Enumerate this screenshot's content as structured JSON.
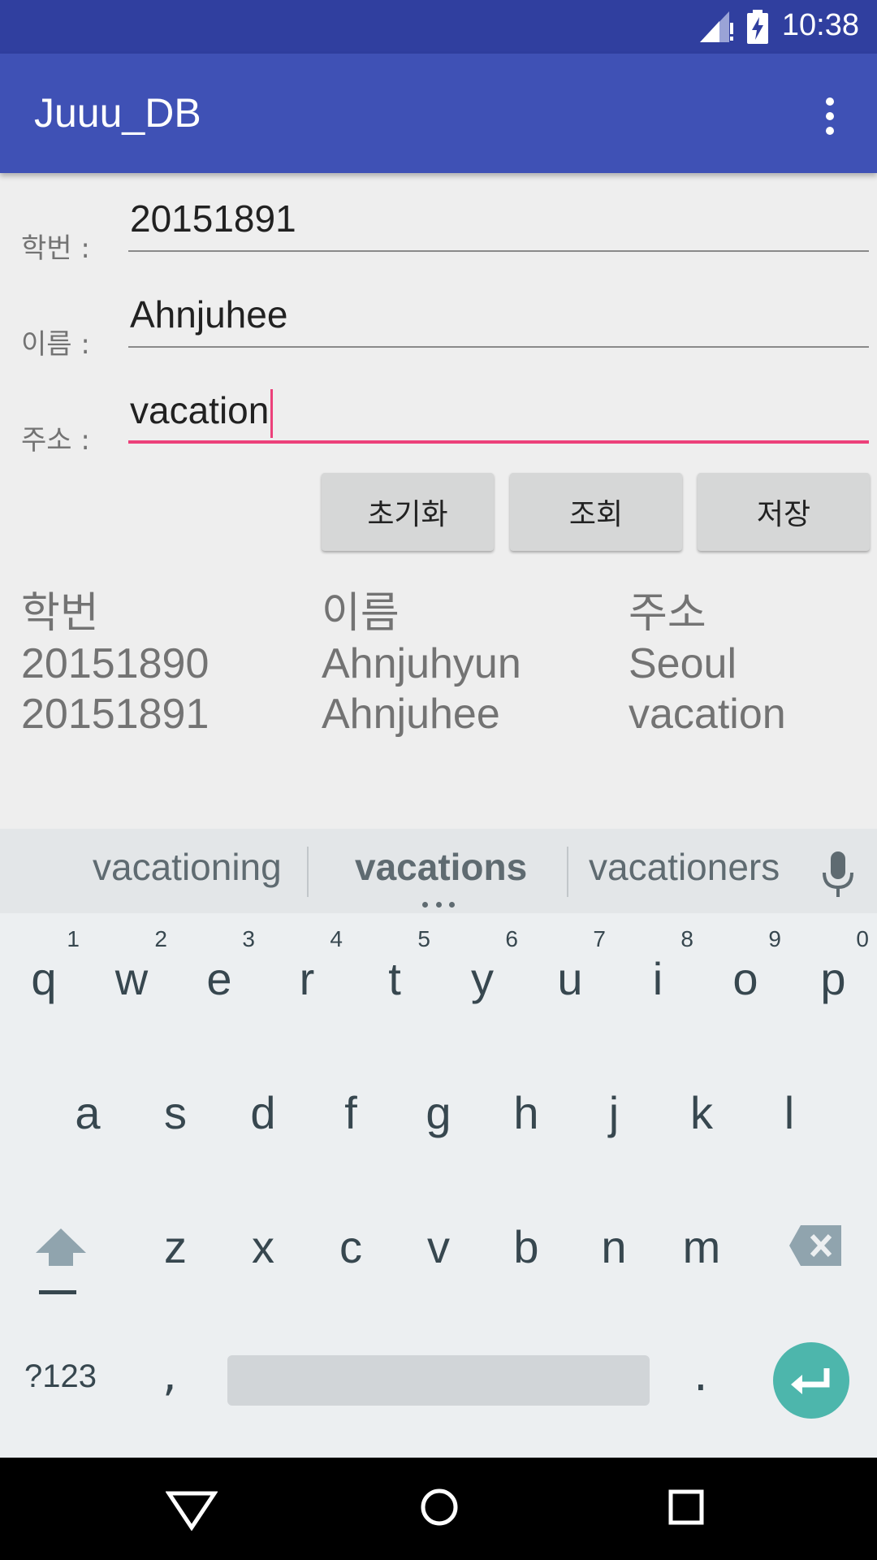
{
  "status_bar": {
    "time": "10:38"
  },
  "app_bar": {
    "title": "Juuu_DB",
    "menu_icon": "overflow-menu-icon"
  },
  "form": {
    "student_id": {
      "label": "학번 :",
      "value": "20151891"
    },
    "name": {
      "label": "이름 :",
      "value": "Ahnjuhee"
    },
    "address": {
      "label": "주소 :",
      "value": "vacation"
    }
  },
  "buttons": {
    "reset": "초기화",
    "query": "조회",
    "save": "저장"
  },
  "records": {
    "headers": [
      "학번",
      "이름",
      "주소"
    ],
    "rows": [
      [
        "20151890",
        "Ahnjuhyun",
        "Seoul"
      ],
      [
        "20151891",
        "Ahnjuhee",
        "vacation"
      ]
    ]
  },
  "keyboard": {
    "suggestions": [
      "vacationing",
      "vacations",
      "vacationers"
    ],
    "row1": [
      {
        "k": "q",
        "h": "1"
      },
      {
        "k": "w",
        "h": "2"
      },
      {
        "k": "e",
        "h": "3"
      },
      {
        "k": "r",
        "h": "4"
      },
      {
        "k": "t",
        "h": "5"
      },
      {
        "k": "y",
        "h": "6"
      },
      {
        "k": "u",
        "h": "7"
      },
      {
        "k": "i",
        "h": "8"
      },
      {
        "k": "o",
        "h": "9"
      },
      {
        "k": "p",
        "h": "0"
      }
    ],
    "row2": [
      "a",
      "s",
      "d",
      "f",
      "g",
      "h",
      "j",
      "k",
      "l"
    ],
    "row3": [
      "z",
      "x",
      "c",
      "v",
      "b",
      "n",
      "m"
    ],
    "symbols_label": "?123",
    "comma": ",",
    "period": "."
  },
  "colors": {
    "status_bar": "#303F9F",
    "app_bar": "#3F51B5",
    "accent": "#EC407A",
    "enter_key": "#4DB6AC"
  }
}
